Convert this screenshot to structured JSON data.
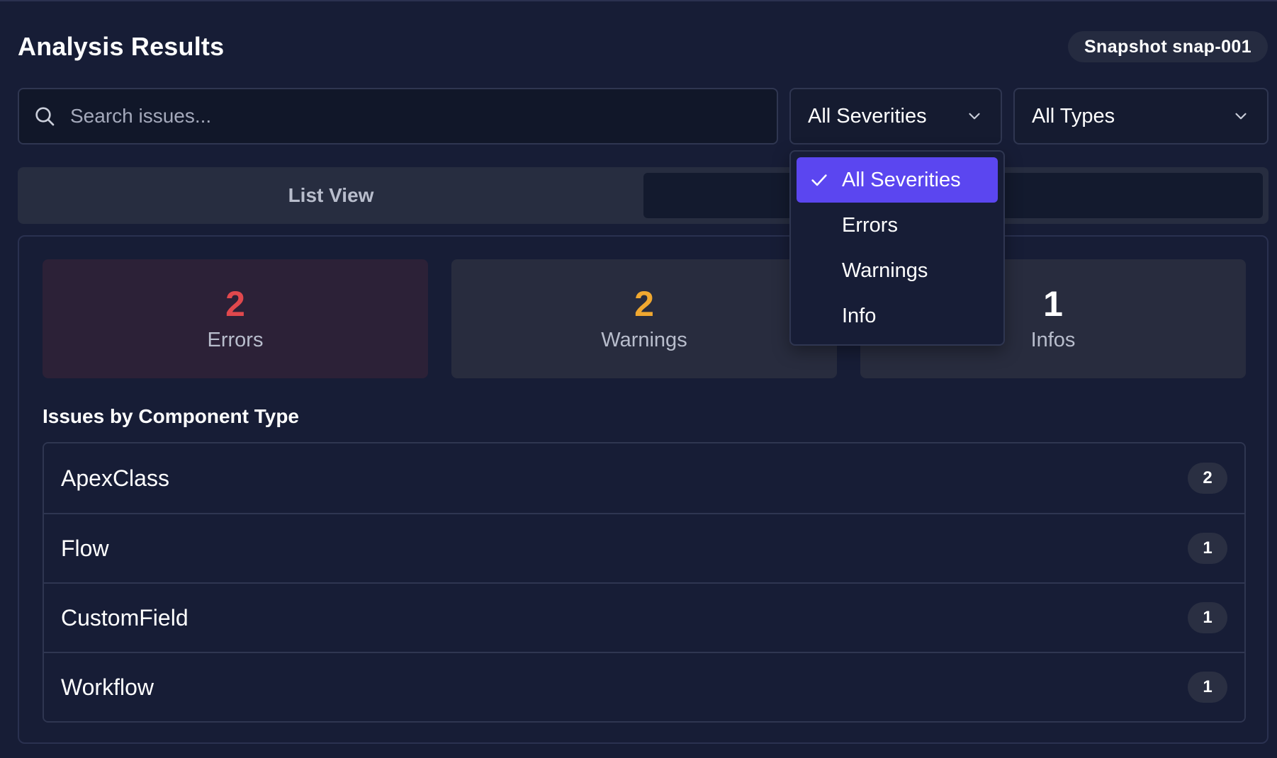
{
  "header": {
    "title": "Analysis Results",
    "snapshot_badge": "Snapshot snap-001"
  },
  "filters": {
    "search_placeholder": "Search issues...",
    "search_value": "",
    "severity_selected": "All Severities",
    "type_selected": "All Types",
    "severity_options": [
      {
        "label": "All Severities",
        "selected": true
      },
      {
        "label": "Errors",
        "selected": false
      },
      {
        "label": "Warnings",
        "selected": false
      },
      {
        "label": "Info",
        "selected": false
      }
    ]
  },
  "tabs": {
    "list_view_label": "List View"
  },
  "summary": {
    "errors": {
      "count": "2",
      "label": "Errors",
      "color": "#e0484d"
    },
    "warnings": {
      "count": "2",
      "label": "Warnings",
      "color": "#f0a830"
    },
    "infos": {
      "count": "1",
      "label": "Infos",
      "color": "#ffffff"
    }
  },
  "component_types": {
    "title": "Issues by Component Type",
    "rows": [
      {
        "name": "ApexClass",
        "count": "2"
      },
      {
        "name": "Flow",
        "count": "1"
      },
      {
        "name": "CustomField",
        "count": "1"
      },
      {
        "name": "Workflow",
        "count": "1"
      }
    ]
  },
  "colors": {
    "accent": "#5b46f0",
    "background": "#171d36"
  }
}
